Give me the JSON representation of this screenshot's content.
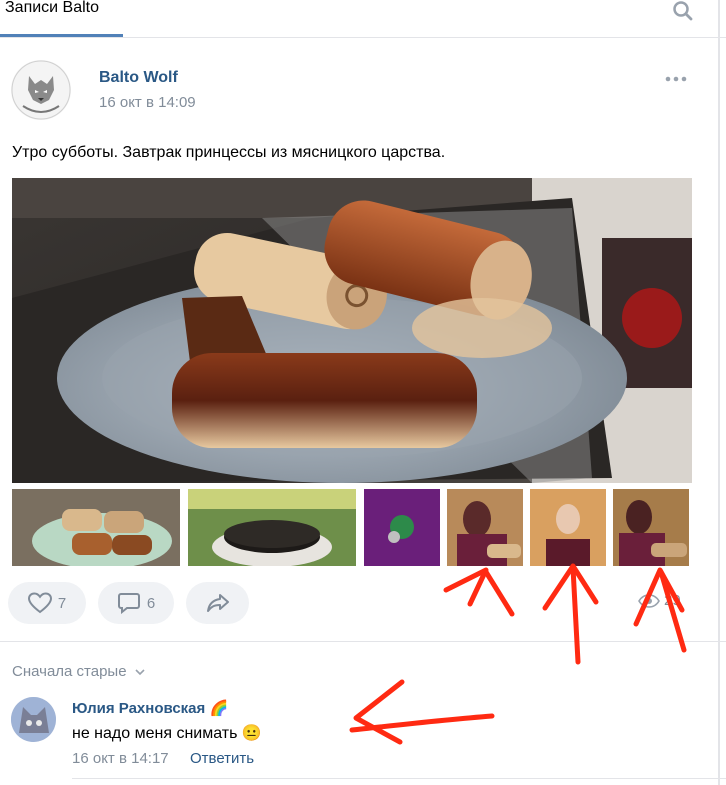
{
  "header": {
    "title": "Записи Balto",
    "search_icon": "search-icon"
  },
  "post": {
    "author": "Balto Wolf",
    "date": "16 окт в 14:09",
    "avatar_caption": "Balto Wolf HD",
    "text": "Утро субботы. Завтрак принцессы из мясницкого царства.",
    "likes": "7",
    "comments": "6",
    "views": "29"
  },
  "comments": {
    "sort_label": "Сначала старые",
    "items": [
      {
        "author": "Юлия Рахновская",
        "author_badge": "🌈",
        "text": "не надо меня снимать",
        "emoji": "😐",
        "date": "16 окт в 14:17",
        "reply_label": "Ответить"
      }
    ]
  },
  "colors": {
    "accent": "#5181b8",
    "link": "#2a5885",
    "muted": "#818c99",
    "annotation": "#ff2a12"
  }
}
